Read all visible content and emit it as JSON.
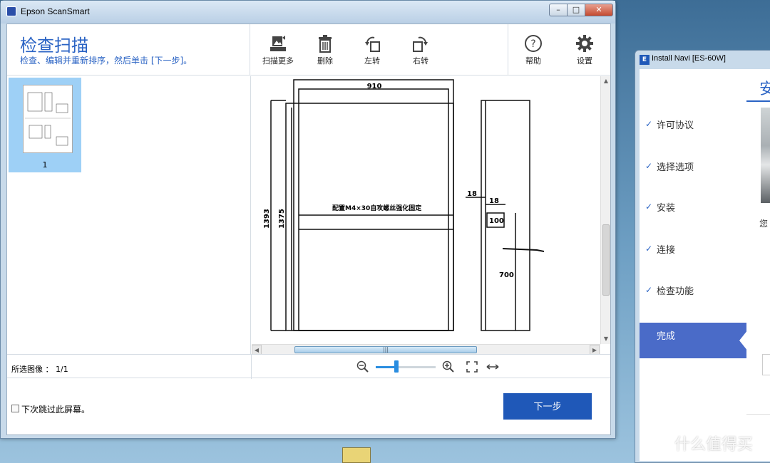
{
  "main_window": {
    "title": "Epson ScanSmart",
    "page_title": "检查扫描",
    "page_subtitle": "检查、编辑并重新排序，然后单击 [下一步]。",
    "toolbar": [
      {
        "label": "扫描更多",
        "icon": "scan-more-icon"
      },
      {
        "label": "删除",
        "icon": "trash-icon"
      },
      {
        "label": "左转",
        "icon": "rotate-left-icon"
      },
      {
        "label": "右转",
        "icon": "rotate-right-icon"
      },
      {
        "label": "帮助",
        "icon": "help-icon"
      },
      {
        "label": "设置",
        "icon": "gear-icon"
      }
    ],
    "thumbnail": {
      "page_number": "1",
      "selected": true
    },
    "drawing": {
      "dim_top": "910",
      "dim_left_outer": "1393",
      "dim_left_inner": "1375",
      "note": "配置M4×30自攻螺丝强化固定",
      "dim_side_a": "18",
      "dim_side_b": "18",
      "dim_box": "100",
      "dim_depth": "700"
    },
    "status": "所选图像 ： 1/1",
    "zoom": {
      "level": 0.35
    },
    "skip_checkbox": {
      "label": "下次跳过此屏幕。",
      "checked": false
    },
    "next_button": "下一步"
  },
  "install_window": {
    "title": "Install Navi [ES-60W]",
    "icon_letter": "E",
    "header_partial": "安",
    "steps": [
      {
        "label": "许可协议",
        "done": true
      },
      {
        "label": "选择选项",
        "done": true
      },
      {
        "label": "安装",
        "done": true
      },
      {
        "label": "连接",
        "done": true
      },
      {
        "label": "检查功能",
        "done": true
      },
      {
        "label": "完成",
        "done": false,
        "active": true
      }
    ],
    "partial_text": "您",
    "checkmark": "✓"
  },
  "watermark": "什么值得买",
  "colors": {
    "accent": "#2a63c4",
    "button": "#1f58b8",
    "selection": "#9ed0f6",
    "active_step": "#4a6bc8"
  }
}
